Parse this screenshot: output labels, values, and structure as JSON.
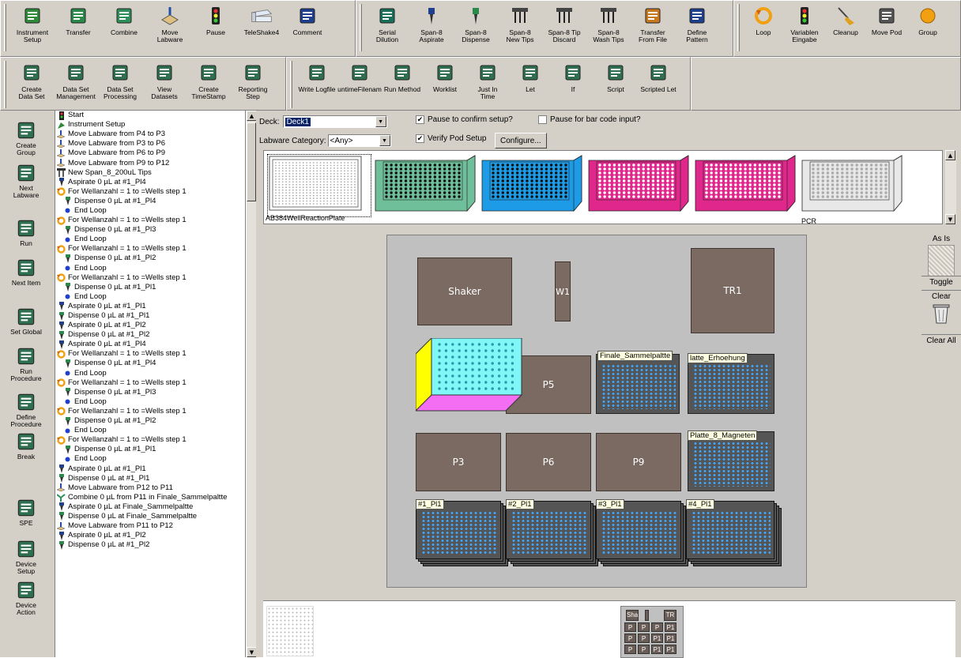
{
  "toolbar_top": [
    {
      "label": "Instrument\nSetup",
      "icon": "instrument-setup-icon"
    },
    {
      "label": "Transfer",
      "icon": "transfer-icon"
    },
    {
      "label": "Combine",
      "icon": "combine-icon"
    },
    {
      "label": "Move\nLabware",
      "icon": "move-labware-icon"
    },
    {
      "label": "Pause",
      "icon": "traffic-light-icon"
    },
    {
      "label": "TeleShake4",
      "icon": "teleshake-icon"
    },
    {
      "label": "Comment",
      "icon": "comment-icon"
    }
  ],
  "toolbar_top_mid": [
    {
      "label": "Serial\nDilution",
      "icon": "serial-dilution-icon"
    },
    {
      "label": "Span-8\nAspirate",
      "icon": "aspirate-icon"
    },
    {
      "label": "Span-8\nDispense",
      "icon": "dispense-icon"
    },
    {
      "label": "Span-8\nNew Tips",
      "icon": "new-tips-icon"
    },
    {
      "label": "Span-8 Tip\nDiscard",
      "icon": "tip-discard-icon"
    },
    {
      "label": "Span-8\nWash Tips",
      "icon": "wash-tips-icon"
    },
    {
      "label": "Transfer\nFrom File",
      "icon": "transfer-file-icon"
    },
    {
      "label": "Define\nPattern",
      "icon": "define-pattern-icon"
    }
  ],
  "toolbar_top_right": [
    {
      "label": "Loop",
      "icon": "loop-icon"
    },
    {
      "label": "Variablen\nEingabe",
      "icon": "variable-input-icon"
    },
    {
      "label": "Cleanup",
      "icon": "broom-icon"
    },
    {
      "label": "Move Pod",
      "icon": "move-pod-icon"
    },
    {
      "label": "Group",
      "icon": "group-icon"
    }
  ],
  "toolbar_second_left": [
    {
      "label": "Create\nData Set",
      "icon": "create-dataset-icon"
    },
    {
      "label": "Data Set\nManagement",
      "icon": "dataset-management-icon"
    },
    {
      "label": "Data Set\nProcessing",
      "icon": "dataset-processing-icon"
    },
    {
      "label": "View\nDatasets",
      "icon": "view-datasets-icon"
    },
    {
      "label": "Create\nTimeStamp",
      "icon": "timestamp-icon"
    },
    {
      "label": "Reporting\nStep",
      "icon": "reporting-icon"
    }
  ],
  "toolbar_second_right": [
    {
      "label": "Write Logfile",
      "icon": "write-logfile-icon"
    },
    {
      "label": "untimeFilenam",
      "icon": "runtime-filename-icon"
    },
    {
      "label": "Run Method",
      "icon": "run-method-icon"
    },
    {
      "label": "Worklist",
      "icon": "worklist-icon"
    },
    {
      "label": "Just In\nTime",
      "icon": "just-in-time-icon"
    },
    {
      "label": "Let",
      "icon": "let-icon"
    },
    {
      "label": "If",
      "icon": "if-icon"
    },
    {
      "label": "Script",
      "icon": "script-icon"
    },
    {
      "label": "Scripted Let",
      "icon": "scripted-let-icon"
    }
  ],
  "sidebar": [
    {
      "label": "Create\nGroup",
      "icon": "create-group-icon"
    },
    {
      "label": "Next\nLabware",
      "icon": "next-labware-icon"
    },
    {
      "label": "Run",
      "icon": "run-icon"
    },
    {
      "label": "Next Item",
      "icon": "next-item-icon"
    },
    {
      "label": "Set Global",
      "icon": "set-global-icon"
    },
    {
      "label": "Run\nProcedure",
      "icon": "run-procedure-icon"
    },
    {
      "label": "Define\nProcedure",
      "icon": "define-procedure-icon"
    },
    {
      "label": "Break",
      "icon": "break-icon"
    },
    {
      "label": "SPE",
      "icon": "spe-icon"
    },
    {
      "label": "Device\nSetup",
      "icon": "device-setup-icon"
    },
    {
      "label": "Device\nAction",
      "icon": "device-action-icon"
    }
  ],
  "tree": [
    {
      "t": "Start",
      "i": "start",
      "d": 0
    },
    {
      "t": "Instrument Setup",
      "i": "setup",
      "d": 0
    },
    {
      "t": "Move Labware from P4 to P3",
      "i": "move",
      "d": 0
    },
    {
      "t": "Move Labware from P3 to P6",
      "i": "move",
      "d": 0
    },
    {
      "t": "Move Labware from P6 to P9",
      "i": "move",
      "d": 0
    },
    {
      "t": "Move Labware from P9 to P12",
      "i": "move",
      "d": 0
    },
    {
      "t": "New Span_8_200uL Tips",
      "i": "tips",
      "d": 0
    },
    {
      "t": "Aspirate 0 µL at #1_Pl4",
      "i": "asp",
      "d": 0
    },
    {
      "t": "For Wellanzahl = 1 to =Wells step 1",
      "i": "loop",
      "d": 0
    },
    {
      "t": "Dispense 0 µL at #1_Pl4",
      "i": "disp",
      "d": 1
    },
    {
      "t": "End Loop",
      "i": "end",
      "d": 1
    },
    {
      "t": "For Wellanzahl = 1 to =Wells step 1",
      "i": "loop",
      "d": 0
    },
    {
      "t": "Dispense 0 µL at #1_Pl3",
      "i": "disp",
      "d": 1
    },
    {
      "t": "End Loop",
      "i": "end",
      "d": 1
    },
    {
      "t": "For Wellanzahl = 1 to =Wells step 1",
      "i": "loop",
      "d": 0
    },
    {
      "t": "Dispense 0 µL at #1_Pl2",
      "i": "disp",
      "d": 1
    },
    {
      "t": "End Loop",
      "i": "end",
      "d": 1
    },
    {
      "t": "For Wellanzahl = 1 to =Wells step 1",
      "i": "loop",
      "d": 0
    },
    {
      "t": "Dispense 0 µL at #1_Pl1",
      "i": "disp",
      "d": 1
    },
    {
      "t": "End Loop",
      "i": "end",
      "d": 1
    },
    {
      "t": "Aspirate 0 µL at #1_Pl1",
      "i": "asp",
      "d": 0
    },
    {
      "t": "Dispense 0 µL at #1_Pl1",
      "i": "disp",
      "d": 0
    },
    {
      "t": "Aspirate 0 µL at #1_Pl2",
      "i": "asp",
      "d": 0
    },
    {
      "t": "Dispense 0 µL at #1_Pl2",
      "i": "disp",
      "d": 0
    },
    {
      "t": "Aspirate 0 µL at #1_Pl4",
      "i": "asp",
      "d": 0
    },
    {
      "t": "For Wellanzahl = 1 to =Wells step 1",
      "i": "loop",
      "d": 0
    },
    {
      "t": "Dispense 0 µL at #1_Pl4",
      "i": "disp",
      "d": 1
    },
    {
      "t": "End Loop",
      "i": "end",
      "d": 1
    },
    {
      "t": "For Wellanzahl = 1 to =Wells step 1",
      "i": "loop",
      "d": 0
    },
    {
      "t": "Dispense 0 µL at #1_Pl3",
      "i": "disp",
      "d": 1
    },
    {
      "t": "End Loop",
      "i": "end",
      "d": 1
    },
    {
      "t": "For Wellanzahl = 1 to =Wells step 1",
      "i": "loop",
      "d": 0
    },
    {
      "t": "Dispense 0 µL at #1_Pl2",
      "i": "disp",
      "d": 1
    },
    {
      "t": "End Loop",
      "i": "end",
      "d": 1
    },
    {
      "t": "For Wellanzahl = 1 to =Wells step 1",
      "i": "loop",
      "d": 0
    },
    {
      "t": "Dispense 0 µL at #1_Pl1",
      "i": "disp",
      "d": 1
    },
    {
      "t": "End Loop",
      "i": "end",
      "d": 1
    },
    {
      "t": "Aspirate 0 µL at #1_Pl1",
      "i": "asp",
      "d": 0
    },
    {
      "t": "Dispense 0 µL at #1_Pl1",
      "i": "disp",
      "d": 0
    },
    {
      "t": "Move Labware from P12 to P11",
      "i": "move",
      "d": 0
    },
    {
      "t": "Combine 0 µL from P11 in Finale_Sammelpaltte",
      "i": "combine",
      "d": 0
    },
    {
      "t": "Aspirate 0 µL at Finale_Sammelpaltte",
      "i": "asp",
      "d": 0
    },
    {
      "t": "Dispense 0 µL at Finale_Sammelpaltte",
      "i": "disp",
      "d": 0
    },
    {
      "t": "Move Labware from P11 to P12",
      "i": "move",
      "d": 0
    },
    {
      "t": "Aspirate 0 µL at #1_Pl2",
      "i": "asp",
      "d": 0
    },
    {
      "t": "Dispense 0 µL at #1_Pl2",
      "i": "disp",
      "d": 0
    }
  ],
  "deck": {
    "label": "Deck:",
    "value": "Deck1",
    "pause_confirm": "Pause to confirm setup?",
    "pause_confirm_checked": true,
    "pause_barcode": "Pause for bar code input?",
    "pause_barcode_checked": false,
    "category_label": "Labware Category:",
    "category_value": "<Any>",
    "verify_pod": "Verify Pod Setup",
    "verify_pod_checked": true,
    "configure": "Configure...",
    "palette_first_label": "AB384WellReactionPlate",
    "palette_last_label": "PCR"
  },
  "palette_colors": [
    "#ffffff",
    "#6fbf9a",
    "#1e9be6",
    "#e0288c",
    "#e0288c",
    "#e8e8e8"
  ],
  "sites": {
    "shaker": "Shaker",
    "w1": "W1",
    "tr1": "TR1",
    "p5": "P5",
    "p3": "P3",
    "p6": "P6",
    "p9": "P9"
  },
  "plate_labels": {
    "finale": "Finale_Sammelpaltte",
    "erhoehung": "latte_Erhoehung",
    "magneten": "Platte_8_Magneten",
    "pl1": "#1_Pl1",
    "pl2": "#2_Pl1",
    "pl3": "#3_Pl1",
    "pl4": "#4_Pl1"
  },
  "right_tools": {
    "as_is": "As Is",
    "toggle": "Toggle",
    "clear": "Clear",
    "clear_all": "Clear All"
  },
  "minimap": {
    "row0": [
      "Sha",
      "",
      "TR"
    ],
    "row1": [
      "P",
      "P",
      "P",
      "P1"
    ],
    "row2": [
      "P",
      "P",
      "P1",
      "P1"
    ],
    "row3": [
      "P",
      "P",
      "P1",
      "P1"
    ]
  }
}
